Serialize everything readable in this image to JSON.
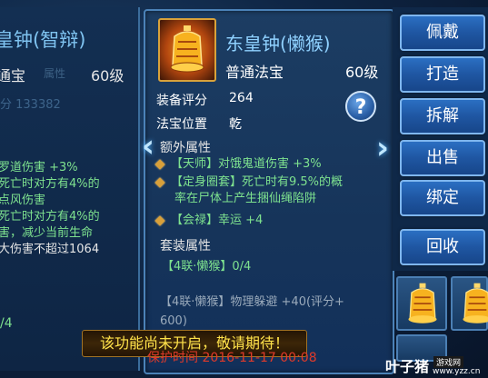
{
  "left_panel": {
    "title": "皇钟(智辩)",
    "type": "通宝",
    "level": "60级",
    "attr_faded": "属性",
    "score_faded": "分 133382",
    "lines": [
      {
        "text": "罗道伤害 +3%",
        "color": "green"
      },
      {
        "text": "死亡时对方有4%的",
        "color": "green"
      },
      {
        "text": "点风伤害",
        "color": "green"
      },
      {
        "text": "死亡时对方有4%的",
        "color": "green"
      },
      {
        "text": "害，减少当前生命",
        "color": "green"
      },
      {
        "text": "大伤害不超过1064",
        "color": "white"
      }
    ],
    "bottom": "/4"
  },
  "item": {
    "name": "东皇钟(懒猴)",
    "type": "普通法宝",
    "level": "60级",
    "score_label": "装备评分",
    "score_value": "264",
    "position_label": "法宝位置",
    "position_value": "乾",
    "extra_title": "额外属性",
    "extra_attrs": [
      {
        "line1": "【天师】对饿鬼道伤害 +3%",
        "line2": ""
      },
      {
        "line1": "【定身圈套】死亡时有9.5%的概",
        "line2": "率在尸体上产生捆仙绳陷阱"
      },
      {
        "line1": "【会禄】幸运 +4",
        "line2": ""
      }
    ],
    "set_title": "套装属性",
    "set_line": "【4联·懒猴】0/4",
    "set_detail_1": "【4联·懒猴】物理躲避 +40(评分+",
    "set_detail_2": "600)"
  },
  "help_label": "?",
  "nav": {
    "left": "‹",
    "right": "›"
  },
  "actions": [
    "佩戴",
    "打造",
    "拆解",
    "出售",
    "绑定",
    "回收"
  ],
  "tip": "该功能尚未开启，敬请期待！",
  "protect_time": "保护时间 2016-11-17 00:08",
  "watermark": {
    "big": "叶子猪",
    "small": "游戏网",
    "url": "www.yzz.cn"
  },
  "colors": {
    "green": "#7ee28f",
    "gold": "#d8a03a",
    "button_blue": "#1f56a2",
    "tip_yellow": "#ffe24a"
  }
}
